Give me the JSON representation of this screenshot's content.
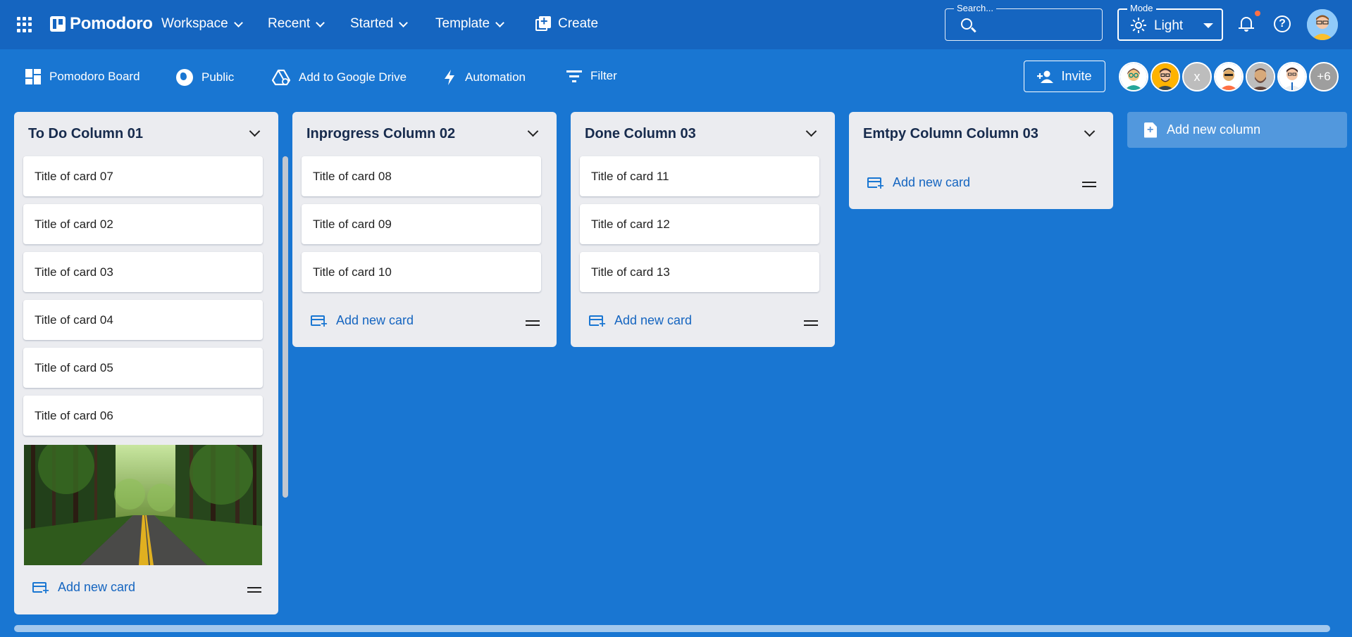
{
  "appbar": {
    "brand": "Pomodoro",
    "nav": [
      {
        "label": "Workspace"
      },
      {
        "label": "Recent"
      },
      {
        "label": "Started"
      },
      {
        "label": "Template"
      }
    ],
    "create_label": "Create",
    "search": {
      "legend": "Search...",
      "placeholder": ""
    },
    "mode": {
      "legend": "Mode",
      "value": "Light"
    }
  },
  "boardbar": {
    "board_name": "Pomodoro Board",
    "visibility": "Public",
    "drive": "Add to Google Drive",
    "automation": "Automation",
    "filter": "Filter",
    "invite": "Invite",
    "avatar_x": "x",
    "more_members": "+6"
  },
  "columns": [
    {
      "title": "To Do Column 01",
      "cards": [
        "Title of card 07",
        "Title of card 02",
        "Title of card 03",
        "Title of card 04",
        "Title of card 05",
        "Title of card 06"
      ],
      "add_card": "Add new card"
    },
    {
      "title": "Inprogress Column 02",
      "cards": [
        "Title of card 08",
        "Title of card 09",
        "Title of card 10"
      ],
      "add_card": "Add new card"
    },
    {
      "title": "Done Column 03",
      "cards": [
        "Title of card 11",
        "Title of card 12",
        "Title of card 13"
      ],
      "add_card": "Add new card"
    },
    {
      "title": "Emtpy Column Column 03",
      "cards": [],
      "add_card": "Add new card"
    }
  ],
  "add_column": "Add new column",
  "colors": {
    "appbar": "#1565c0",
    "board_bg": "#1976d2",
    "column_bg": "#ebecf0",
    "accent": "#1565c0",
    "notification_dot": "#ff7043"
  }
}
